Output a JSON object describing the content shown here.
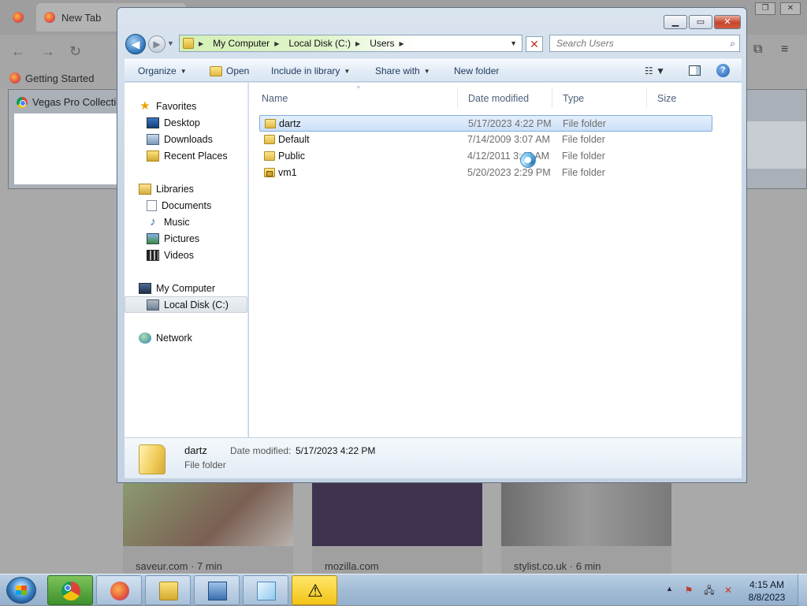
{
  "browser": {
    "tabs": [
      {
        "label": ""
      },
      {
        "label": "New Tab"
      }
    ],
    "bookmark": "Getting Started",
    "behind_window_title": "Vegas Pro Collection",
    "cards": [
      {
        "source": "saveur.com · 7 min"
      },
      {
        "source": "mozilla.com"
      },
      {
        "source": "stylist.co.uk · 6 min"
      }
    ]
  },
  "explorer": {
    "breadcrumb": [
      "My Computer",
      "Local Disk (C:)",
      "Users"
    ],
    "search_placeholder": "Search Users",
    "toolbar": {
      "organize": "Organize",
      "open": "Open",
      "include": "Include in library",
      "share": "Share with",
      "new_folder": "New folder"
    },
    "nav": {
      "favorites": "Favorites",
      "desktop": "Desktop",
      "downloads": "Downloads",
      "recent": "Recent Places",
      "libraries": "Libraries",
      "documents": "Documents",
      "music": "Music",
      "pictures": "Pictures",
      "videos": "Videos",
      "computer": "My Computer",
      "local_disk": "Local Disk (C:)",
      "network": "Network"
    },
    "columns": {
      "name": "Name",
      "date": "Date modified",
      "type": "Type",
      "size": "Size"
    },
    "files": [
      {
        "name": "dartz",
        "date": "5/17/2023 4:22 PM",
        "type": "File folder"
      },
      {
        "name": "Default",
        "date": "7/14/2009 3:07 AM",
        "type": "File folder"
      },
      {
        "name": "Public",
        "date": "4/12/2011 3:45 AM",
        "type": "File folder"
      },
      {
        "name": "vm1",
        "date": "5/20/2023 2:29 PM",
        "type": "File folder"
      }
    ],
    "details": {
      "name": "dartz",
      "type": "File folder",
      "date_label": "Date modified:",
      "date": "5/17/2023 4:22 PM"
    }
  },
  "taskbar": {
    "time": "4:15 AM",
    "date": "8/8/2023"
  },
  "colors": {
    "selection": "#cde0f7",
    "selection_border": "#84acdd",
    "toolbar_text": "#1e395b",
    "header_text": "#4c607a"
  }
}
